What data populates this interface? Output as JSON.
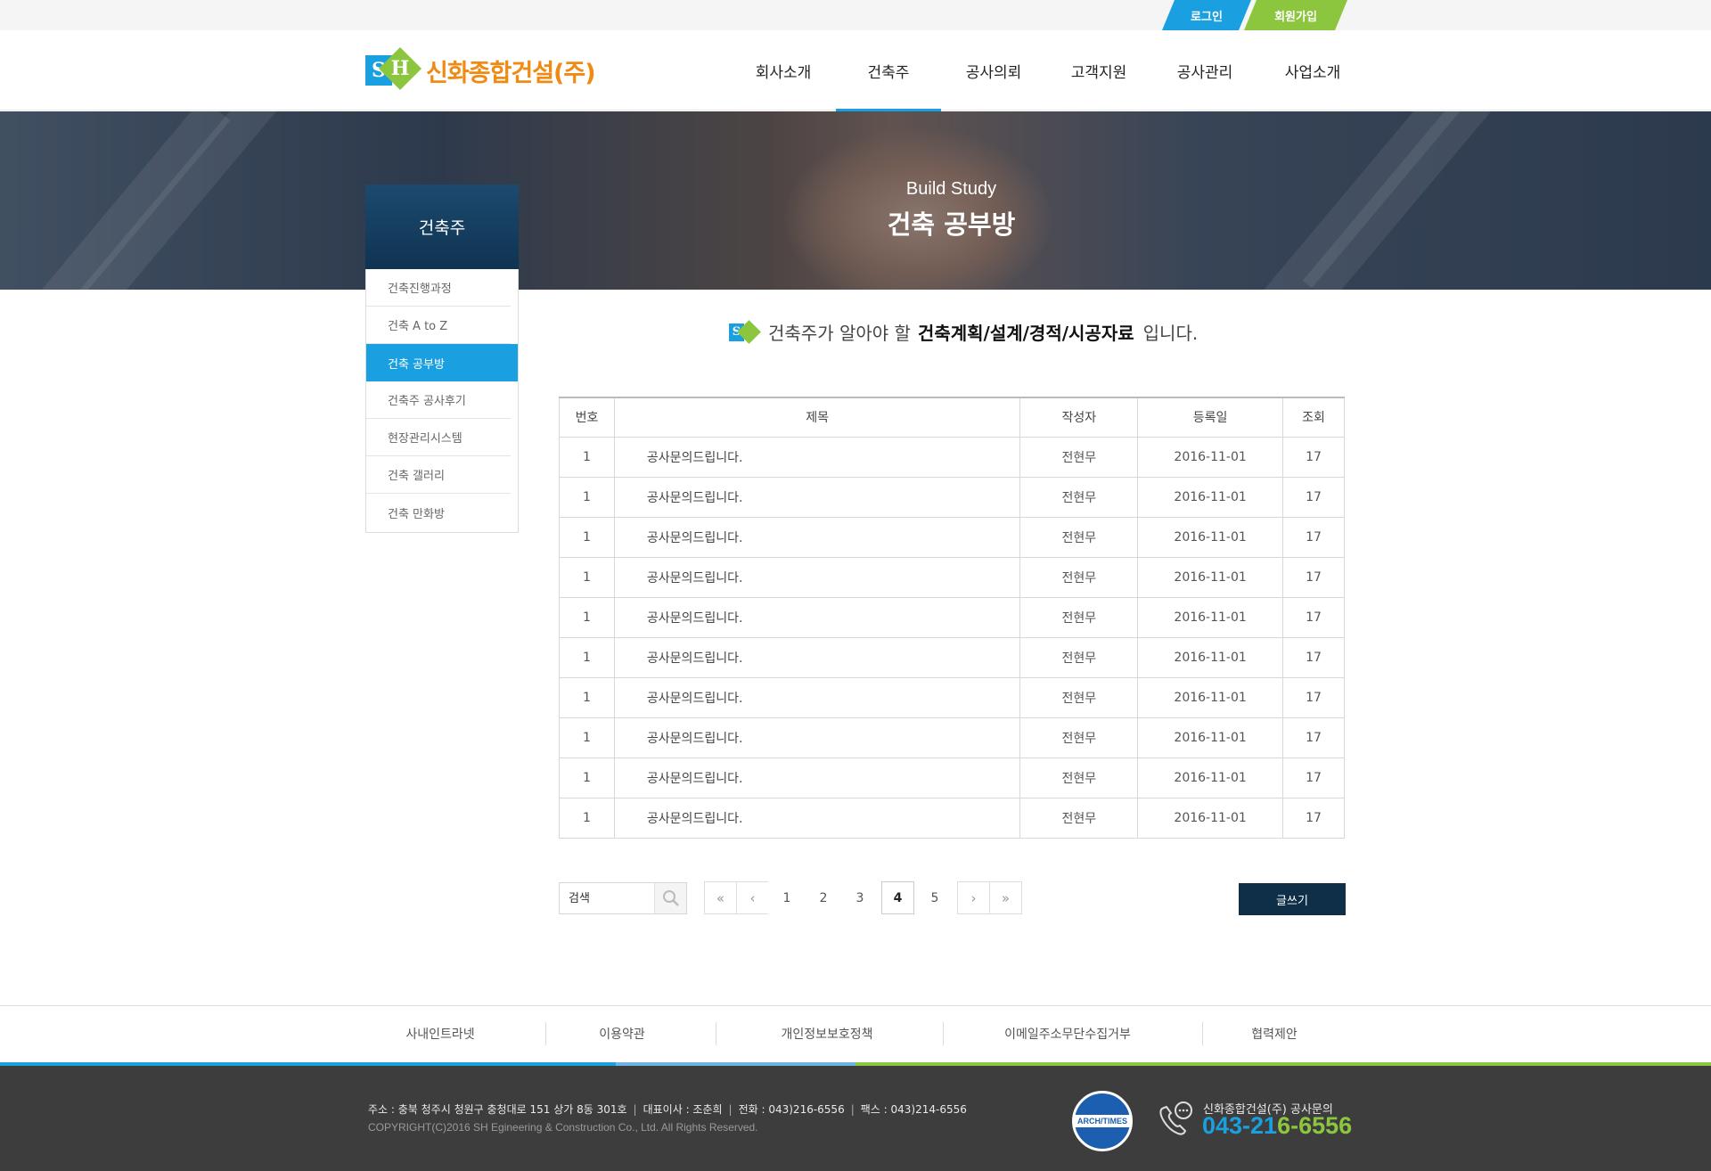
{
  "topbar": {
    "login": "로그인",
    "join": "회원가입"
  },
  "logo": {
    "s": "S",
    "h": "H",
    "text": "신화종합건설(주)"
  },
  "nav": [
    "회사소개",
    "건축주",
    "공사의뢰",
    "고객지원",
    "공사관리",
    "사업소개"
  ],
  "banner": {
    "subtitle": "Build Study",
    "title": "건축 공부방"
  },
  "side": {
    "heading": "건축주",
    "items": [
      "건축진행과정",
      "건축 A to Z",
      "건축 공부방",
      "건축주 공사후기",
      "현장관리시스템",
      "건축 갤러리",
      "건축 만화방"
    ]
  },
  "intro": {
    "before": "건축주가 알아야 할",
    "bold": "건축계획/설계/경적/시공자료",
    "after": "입니다."
  },
  "table": {
    "headers": [
      "번호",
      "제목",
      "작성자",
      "등록일",
      "조회"
    ],
    "rows": [
      [
        "1",
        "공사문의드립니다.",
        "전현무",
        "2016-11-01",
        "17"
      ],
      [
        "1",
        "공사문의드립니다.",
        "전현무",
        "2016-11-01",
        "17"
      ],
      [
        "1",
        "공사문의드립니다.",
        "전현무",
        "2016-11-01",
        "17"
      ],
      [
        "1",
        "공사문의드립니다.",
        "전현무",
        "2016-11-01",
        "17"
      ],
      [
        "1",
        "공사문의드립니다.",
        "전현무",
        "2016-11-01",
        "17"
      ],
      [
        "1",
        "공사문의드립니다.",
        "전현무",
        "2016-11-01",
        "17"
      ],
      [
        "1",
        "공사문의드립니다.",
        "전현무",
        "2016-11-01",
        "17"
      ],
      [
        "1",
        "공사문의드립니다.",
        "전현무",
        "2016-11-01",
        "17"
      ],
      [
        "1",
        "공사문의드립니다.",
        "전현무",
        "2016-11-01",
        "17"
      ],
      [
        "1",
        "공사문의드립니다.",
        "전현무",
        "2016-11-01",
        "17"
      ]
    ]
  },
  "search": {
    "placeholder": "검색"
  },
  "pagination": {
    "first": "«",
    "prev": "‹",
    "pages": [
      "1",
      "2",
      "3",
      "4",
      "5"
    ],
    "current": "4",
    "next": "›",
    "last": "»"
  },
  "write_button": "글쓰기",
  "footer_links": [
    "사내인트라넷",
    "이용약관",
    "개인정보보호정책",
    "이메일주소무단수집거부",
    "협력제안"
  ],
  "footer": {
    "address": "주소 : 충북 청주시 청원구 충청대로 151 상가 8동 301호",
    "ceo": "대표이사 : 조춘희",
    "tel": "전화 : 043)216-6556",
    "fax": "팩스 : 043)214-6556",
    "copyright": "COPYRIGHT(C)2016  SH Egineering & Construction  Co., Ltd. All Rights Reserved.",
    "seal_text": "ARCH/TIMES",
    "cs_label": "신화종합건설(주) 공사문의",
    "cs_number_prefix": "043-21",
    "cs_number_suffix": "6-6556"
  },
  "colors": {
    "accent_blue": "#1a9fe0",
    "accent_green": "#8cc63f",
    "navy": "#0e2f47",
    "logo_orange": "#f08a12"
  },
  "icons": [
    "search-icon",
    "phone-icon",
    "first-page-icon",
    "prev-page-icon",
    "next-page-icon",
    "last-page-icon"
  ]
}
